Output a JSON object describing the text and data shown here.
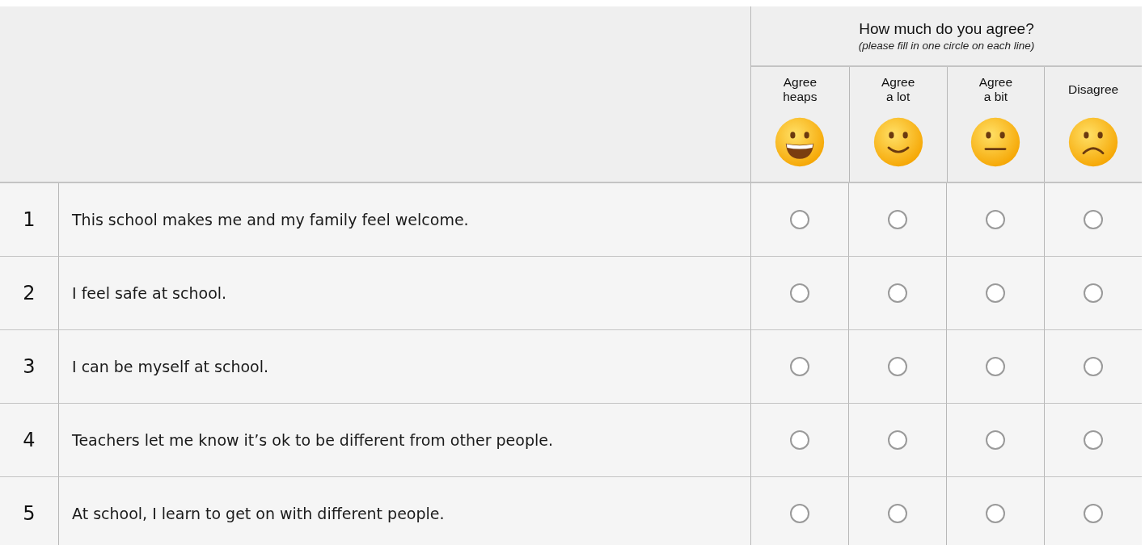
{
  "header": {
    "title": "How much do you agree?",
    "subtitle": "(please fill in one circle on each line)"
  },
  "options": [
    {
      "label": "Agree\nheaps",
      "kind": "grin"
    },
    {
      "label": "Agree\na lot",
      "kind": "smile"
    },
    {
      "label": "Agree\na bit",
      "kind": "neutral"
    },
    {
      "label": "Disagree",
      "kind": "frown"
    }
  ],
  "questions": [
    {
      "number": "1",
      "text": "This school makes me and my family feel welcome.",
      "answers": [
        {
          "selected": false
        },
        {
          "selected": false
        },
        {
          "selected": false
        },
        {
          "selected": false
        }
      ]
    },
    {
      "number": "2",
      "text": "I feel safe at school.",
      "answers": [
        {
          "selected": false
        },
        {
          "selected": false
        },
        {
          "selected": false
        },
        {
          "selected": false
        }
      ]
    },
    {
      "number": "3",
      "text": "I can be myself at school.",
      "answers": [
        {
          "selected": false
        },
        {
          "selected": false
        },
        {
          "selected": false
        },
        {
          "selected": false
        }
      ]
    },
    {
      "number": "4",
      "text": "Teachers let me know it’s ok to be different from other people.",
      "answers": [
        {
          "selected": false
        },
        {
          "selected": false
        },
        {
          "selected": false
        },
        {
          "selected": false
        }
      ]
    },
    {
      "number": "5",
      "text": "At school, I learn to get on with different people.",
      "answers": [
        {
          "selected": false
        },
        {
          "selected": false
        },
        {
          "selected": false
        },
        {
          "selected": false
        }
      ]
    }
  ]
}
